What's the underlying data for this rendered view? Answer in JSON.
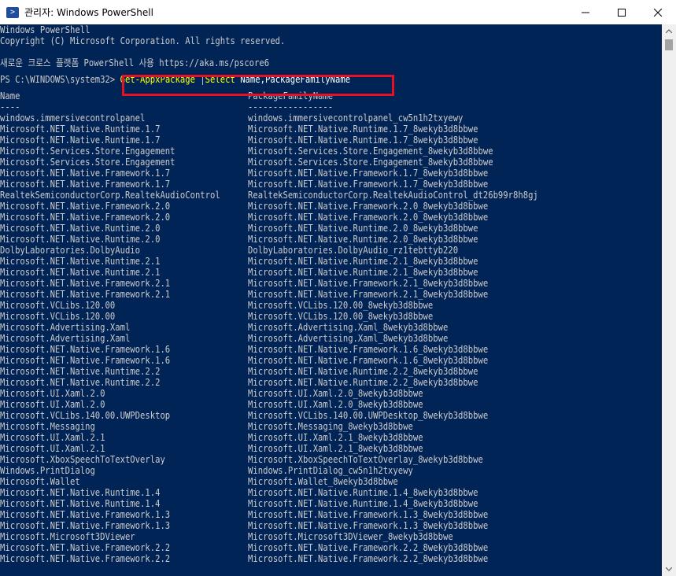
{
  "window": {
    "title": "관리자: Windows PowerShell",
    "app_icon_glyph": ">",
    "colors": {
      "background": "#012456",
      "text": "#cccccc",
      "command": "#ffff00",
      "highlight": "#e81123"
    }
  },
  "header_lines": [
    "Windows PowerShell",
    "Copyright (C) Microsoft Corporation. All rights reserved."
  ],
  "info_line": "새로운 크로스 플랫폼 PowerShell 사용 https://aka.ms/pscore6",
  "prompt": {
    "path": "PS C:\\WINDOWS\\system32>",
    "command": "Get-AppxPackage",
    "pipe": " |",
    "select_cmd": "Select",
    "args": " Name,PackageFamilyName"
  },
  "table": {
    "headers": [
      "Name",
      "PackageFamilyName"
    ],
    "underlines": [
      "----",
      "-----------------"
    ],
    "rows": [
      [
        "windows.immersivecontrolpanel",
        "windows.immersivecontrolpanel_cw5n1h2txyewy"
      ],
      [
        "Microsoft.NET.Native.Runtime.1.7",
        "Microsoft.NET.Native.Runtime.1.7_8wekyb3d8bbwe"
      ],
      [
        "Microsoft.NET.Native.Runtime.1.7",
        "Microsoft.NET.Native.Runtime.1.7_8wekyb3d8bbwe"
      ],
      [
        "Microsoft.Services.Store.Engagement",
        "Microsoft.Services.Store.Engagement_8wekyb3d8bbwe"
      ],
      [
        "Microsoft.Services.Store.Engagement",
        "Microsoft.Services.Store.Engagement_8wekyb3d8bbwe"
      ],
      [
        "Microsoft.NET.Native.Framework.1.7",
        "Microsoft.NET.Native.Framework.1.7_8wekyb3d8bbwe"
      ],
      [
        "Microsoft.NET.Native.Framework.1.7",
        "Microsoft.NET.Native.Framework.1.7_8wekyb3d8bbwe"
      ],
      [
        "RealtekSemiconductorCorp.RealtekAudioControl",
        "RealtekSemiconductorCorp.RealtekAudioControl_dt26b99r8h8gj"
      ],
      [
        "Microsoft.NET.Native.Framework.2.0",
        "Microsoft.NET.Native.Framework.2.0_8wekyb3d8bbwe"
      ],
      [
        "Microsoft.NET.Native.Framework.2.0",
        "Microsoft.NET.Native.Framework.2.0_8wekyb3d8bbwe"
      ],
      [
        "Microsoft.NET.Native.Runtime.2.0",
        "Microsoft.NET.Native.Runtime.2.0_8wekyb3d8bbwe"
      ],
      [
        "Microsoft.NET.Native.Runtime.2.0",
        "Microsoft.NET.Native.Runtime.2.0_8wekyb3d8bbwe"
      ],
      [
        "DolbyLaboratories.DolbyAudio",
        "DolbyLaboratories.DolbyAudio_rz1tebttyb220"
      ],
      [
        "Microsoft.NET.Native.Runtime.2.1",
        "Microsoft.NET.Native.Runtime.2.1_8wekyb3d8bbwe"
      ],
      [
        "Microsoft.NET.Native.Runtime.2.1",
        "Microsoft.NET.Native.Runtime.2.1_8wekyb3d8bbwe"
      ],
      [
        "Microsoft.NET.Native.Framework.2.1",
        "Microsoft.NET.Native.Framework.2.1_8wekyb3d8bbwe"
      ],
      [
        "Microsoft.NET.Native.Framework.2.1",
        "Microsoft.NET.Native.Framework.2.1_8wekyb3d8bbwe"
      ],
      [
        "Microsoft.VCLibs.120.00",
        "Microsoft.VCLibs.120.00_8wekyb3d8bbwe"
      ],
      [
        "Microsoft.VCLibs.120.00",
        "Microsoft.VCLibs.120.00_8wekyb3d8bbwe"
      ],
      [
        "Microsoft.Advertising.Xaml",
        "Microsoft.Advertising.Xaml_8wekyb3d8bbwe"
      ],
      [
        "Microsoft.Advertising.Xaml",
        "Microsoft.Advertising.Xaml_8wekyb3d8bbwe"
      ],
      [
        "Microsoft.NET.Native.Framework.1.6",
        "Microsoft.NET.Native.Framework.1.6_8wekyb3d8bbwe"
      ],
      [
        "Microsoft.NET.Native.Framework.1.6",
        "Microsoft.NET.Native.Framework.1.6_8wekyb3d8bbwe"
      ],
      [
        "Microsoft.NET.Native.Runtime.2.2",
        "Microsoft.NET.Native.Runtime.2.2_8wekyb3d8bbwe"
      ],
      [
        "Microsoft.NET.Native.Runtime.2.2",
        "Microsoft.NET.Native.Runtime.2.2_8wekyb3d8bbwe"
      ],
      [
        "Microsoft.UI.Xaml.2.0",
        "Microsoft.UI.Xaml.2.0_8wekyb3d8bbwe"
      ],
      [
        "Microsoft.UI.Xaml.2.0",
        "Microsoft.UI.Xaml.2.0_8wekyb3d8bbwe"
      ],
      [
        "Microsoft.VCLibs.140.00.UWPDesktop",
        "Microsoft.VCLibs.140.00.UWPDesktop_8wekyb3d8bbwe"
      ],
      [
        "Microsoft.Messaging",
        "Microsoft.Messaging_8wekyb3d8bbwe"
      ],
      [
        "Microsoft.UI.Xaml.2.1",
        "Microsoft.UI.Xaml.2.1_8wekyb3d8bbwe"
      ],
      [
        "Microsoft.UI.Xaml.2.1",
        "Microsoft.UI.Xaml.2.1_8wekyb3d8bbwe"
      ],
      [
        "Microsoft.XboxSpeechToTextOverlay",
        "Microsoft.XboxSpeechToTextOverlay_8wekyb3d8bbwe"
      ],
      [
        "Windows.PrintDialog",
        "Windows.PrintDialog_cw5n1h2txyewy"
      ],
      [
        "Microsoft.Wallet",
        "Microsoft.Wallet_8wekyb3d8bbwe"
      ],
      [
        "Microsoft.NET.Native.Runtime.1.4",
        "Microsoft.NET.Native.Runtime.1.4_8wekyb3d8bbwe"
      ],
      [
        "Microsoft.NET.Native.Runtime.1.4",
        "Microsoft.NET.Native.Runtime.1.4_8wekyb3d8bbwe"
      ],
      [
        "Microsoft.NET.Native.Framework.1.3",
        "Microsoft.NET.Native.Framework.1.3_8wekyb3d8bbwe"
      ],
      [
        "Microsoft.NET.Native.Framework.1.3",
        "Microsoft.NET.Native.Framework.1.3_8wekyb3d8bbwe"
      ],
      [
        "Microsoft.Microsoft3DViewer",
        "Microsoft.Microsoft3DViewer_8wekyb3d8bbwe"
      ],
      [
        "Microsoft.NET.Native.Framework.2.2",
        "Microsoft.NET.Native.Framework.2.2_8wekyb3d8bbwe"
      ],
      [
        "Microsoft.NET.Native.Framework.2.2",
        "Microsoft.NET.Native.Framework.2.2_8wekyb3d8bbwe"
      ]
    ]
  }
}
